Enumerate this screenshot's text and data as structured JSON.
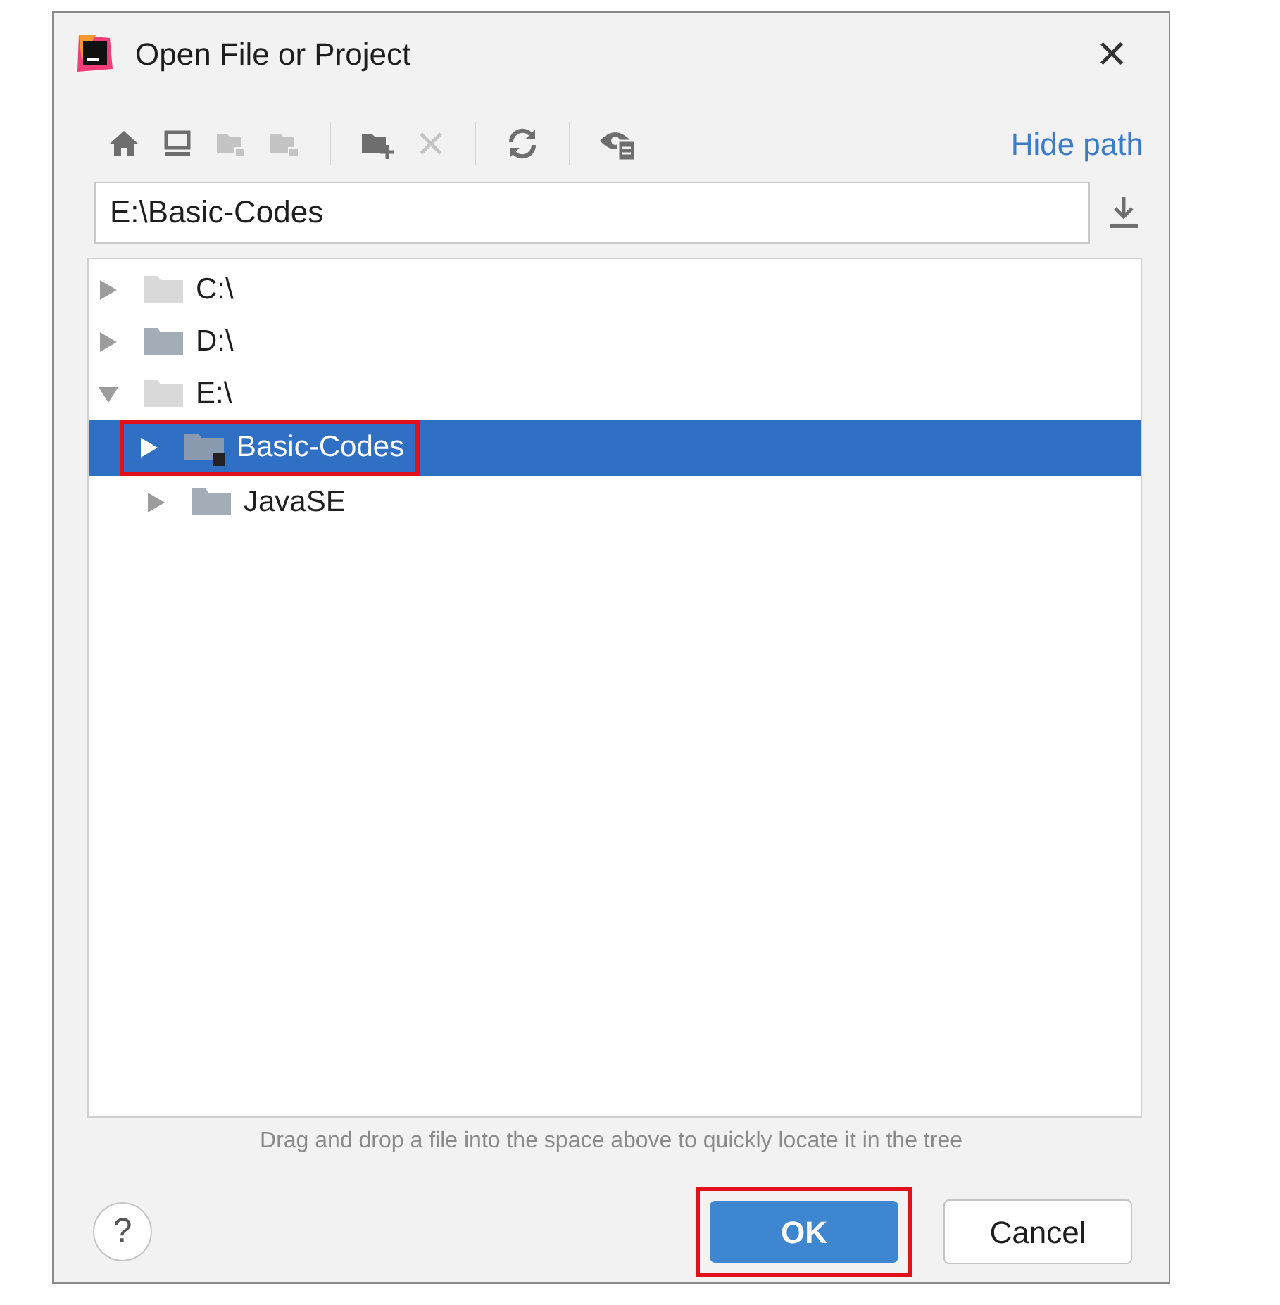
{
  "window": {
    "title": "Open File or Project",
    "close": "×"
  },
  "toolbar": [
    {
      "kind": "home",
      "disabled": false
    },
    {
      "kind": "desktop",
      "disabled": false
    },
    {
      "kind": "folder",
      "disabled": true
    },
    {
      "kind": "folder",
      "disabled": true
    },
    {
      "kind": "separator"
    },
    {
      "kind": "new-folder",
      "disabled": false
    },
    {
      "kind": "delete",
      "disabled": true
    },
    {
      "kind": "separator"
    },
    {
      "kind": "refresh",
      "disabled": false
    },
    {
      "kind": "separator"
    },
    {
      "kind": "hidden",
      "disabled": false
    }
  ],
  "hide_path_link": "Hide path",
  "path_field": {
    "value": "E:\\Basic-Codes"
  },
  "tree": [
    {
      "label": "C:\\",
      "expanded": false,
      "selected": false,
      "dimmed": true,
      "highlighted": false
    },
    {
      "label": "D:\\",
      "expanded": false,
      "selected": false,
      "dimmed": false,
      "highlighted": false
    },
    {
      "label": "E:\\",
      "expanded": true,
      "selected": false,
      "dimmed": true,
      "highlighted": false,
      "children": [
        {
          "label": "Basic-Codes",
          "expanded": false,
          "selected": true,
          "dimmed": false,
          "highlighted": true
        },
        {
          "label": "JavaSE",
          "expanded": false,
          "selected": false,
          "dimmed": false,
          "highlighted": false
        }
      ]
    }
  ],
  "hint": "Drag and drop a file into the space above to quickly locate it in the tree",
  "help_button": "?",
  "buttons": [
    {
      "label": "OK",
      "primary": true,
      "highlighted": true
    },
    {
      "label": "Cancel",
      "primary": false,
      "highlighted": false
    }
  ]
}
